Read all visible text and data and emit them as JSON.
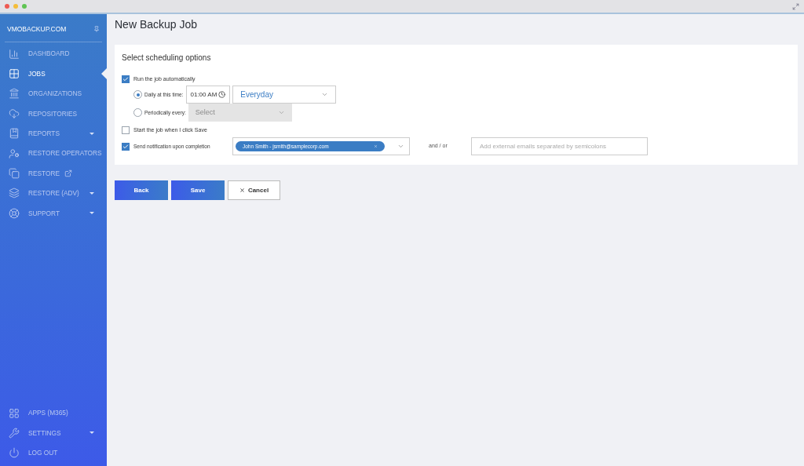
{
  "sidebar": {
    "brand": "VMOBACKUP.COM",
    "items": [
      {
        "label": "DASHBOARD",
        "selected": false
      },
      {
        "label": "JOBS",
        "selected": true
      },
      {
        "label": "ORGANIZATIONS",
        "selected": false
      },
      {
        "label": "REPOSITORIES",
        "selected": false
      },
      {
        "label": "REPORTS",
        "selected": false,
        "caret": true
      },
      {
        "label": "RESTORE OPERATORS",
        "selected": false
      },
      {
        "label": "RESTORE",
        "selected": false,
        "external": true
      },
      {
        "label": "RESTORE (ADV)",
        "selected": false,
        "caret": true
      },
      {
        "label": "SUPPORT",
        "selected": false,
        "caret": true
      }
    ],
    "bottom_items": [
      {
        "label": "APPS (M365)",
        "selected": false
      },
      {
        "label": "SETTINGS",
        "selected": false,
        "caret": true
      },
      {
        "label": "LOG OUT",
        "selected": false
      }
    ]
  },
  "page": {
    "title": "New Backup Job",
    "card": {
      "heading": "Select scheduling options",
      "run_automatically": {
        "label": "Run the job automatically",
        "checked": true
      },
      "daily": {
        "label": "Daily at this time:",
        "selected": true,
        "time": "01:00 AM",
        "frequency": "Everyday"
      },
      "periodic": {
        "label": "Periodically every:",
        "selected": false,
        "placeholder": "Select",
        "disabled": true
      },
      "start_on_save": {
        "label": "Start the job when I click Save",
        "checked": false
      },
      "notify": {
        "label": "Send notification upon completion",
        "checked": true,
        "recipients": [
          "John Smith - jsmith@samplecorp.com"
        ],
        "joiner": "and / or",
        "external_placeholder": "Add external emails separated by semicolons"
      }
    },
    "buttons": [
      {
        "label": "Back",
        "kind": "primary"
      },
      {
        "label": "Save",
        "kind": "primary"
      },
      {
        "label": "Cancel",
        "kind": "cancel"
      }
    ]
  }
}
